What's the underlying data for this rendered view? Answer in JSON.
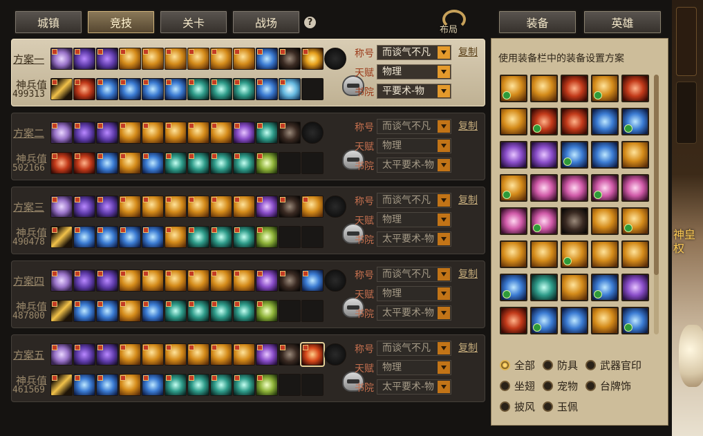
{
  "tabs": [
    {
      "label": "城镇",
      "active": false
    },
    {
      "label": "竞技",
      "active": true
    },
    {
      "label": "关卡",
      "active": false
    },
    {
      "label": "战场",
      "active": false
    }
  ],
  "help_icon_text": "?",
  "layout_button_label": "布局",
  "right_tabs": [
    "装备",
    "英雄"
  ],
  "world_glimpse_text": "神皇\n权",
  "colors": {
    "gold": "#e49a2c",
    "field_label": "#c6704f",
    "panel": "#2c2723",
    "active_panel": "#d9cdb4"
  },
  "plans": [
    {
      "name": "方案一",
      "power_label": "神兵值",
      "power": "499313",
      "active": true,
      "title_label": "称号",
      "title_value": "而谈气不凡",
      "talent_label": "天赋",
      "talent_value": "物理",
      "academy_label": "书院",
      "academy_value": "平要术-物",
      "copy_label": "复制",
      "row1": [
        "disc",
        "wing-purple",
        "wing-purple",
        "gold",
        "gold",
        "gold",
        "gold",
        "gold",
        "gold",
        "blue",
        "dark",
        "gold-wing",
        "ring"
      ],
      "row2": [
        "weapon",
        "red",
        "blue",
        "blue",
        "blue",
        "blue",
        "teal",
        "teal",
        "teal",
        "blue",
        "ice",
        "empty",
        "helmet"
      ]
    },
    {
      "name": "方案二",
      "power_label": "神兵值",
      "power": "502166",
      "active": false,
      "title_label": "称号",
      "title_value": "而谈气不凡",
      "talent_label": "天赋",
      "talent_value": "物理",
      "academy_label": "书院",
      "academy_value": "太平要术-物",
      "copy_label": "复制",
      "row1": [
        "disc",
        "wing-purple",
        "wing-purple",
        "gold",
        "gold",
        "gold",
        "gold",
        "gold",
        "purple",
        "teal",
        "dark",
        "ring"
      ],
      "row2": [
        "red",
        "red",
        "blue",
        "gold",
        "blue",
        "teal",
        "teal",
        "teal",
        "teal",
        "green",
        "empty",
        "empty",
        "helmet"
      ]
    },
    {
      "name": "方案三",
      "power_label": "神兵值",
      "power": "490478",
      "active": false,
      "title_label": "称号",
      "title_value": "而谈气不凡",
      "talent_label": "天赋",
      "talent_value": "物理",
      "academy_label": "书院",
      "academy_value": "太平要术-物",
      "copy_label": "复制",
      "row1": [
        "disc",
        "wing-purple",
        "wing-purple",
        "gold",
        "gold",
        "gold",
        "gold",
        "gold",
        "gold",
        "purple",
        "dark",
        "gold",
        "ring"
      ],
      "row2": [
        "weapon",
        "blue",
        "blue",
        "blue",
        "blue",
        "gold",
        "teal",
        "teal",
        "teal",
        "green",
        "empty",
        "empty",
        "helmet"
      ]
    },
    {
      "name": "方案四",
      "power_label": "神兵值",
      "power": "487800",
      "active": false,
      "title_label": "称号",
      "title_value": "而谈气不凡",
      "talent_label": "天赋",
      "talent_value": "物理",
      "academy_label": "书院",
      "academy_value": "太平要术-物",
      "copy_label": "复制",
      "row1": [
        "disc",
        "wing-purple",
        "wing-purple",
        "gold",
        "gold",
        "gold",
        "gold",
        "gold",
        "gold",
        "purple",
        "dark",
        "blue",
        "ring"
      ],
      "row2": [
        "weapon",
        "blue",
        "blue",
        "gold",
        "blue",
        "teal",
        "teal",
        "teal",
        "teal",
        "green",
        "empty",
        "empty",
        "helmet"
      ]
    },
    {
      "name": "方案五",
      "power_label": "神兵值",
      "power": "461569",
      "active": false,
      "title_label": "称号",
      "title_value": "而谈气不凡",
      "talent_label": "天赋",
      "talent_value": "物理",
      "academy_label": "书院",
      "academy_value": "太平要术-物",
      "copy_label": "复制",
      "row1": [
        "disc",
        "wing-purple",
        "wing-purple",
        "gold",
        "gold",
        "gold",
        "gold",
        "gold",
        "gold",
        "purple",
        "dark",
        "red-sel",
        "ring"
      ],
      "row2": [
        "weapon",
        "blue",
        "blue",
        "gold",
        "blue",
        "teal",
        "teal",
        "teal",
        "teal",
        "green",
        "empty",
        "empty",
        "helmet"
      ]
    }
  ],
  "equip_panel": {
    "hint": "使用装备栏中的装备设置方案",
    "items": [
      "gold",
      "gold",
      "red",
      "gold",
      "red",
      "gold",
      "red",
      "red",
      "blue",
      "blue",
      "purple",
      "purple",
      "blue",
      "blue",
      "gold",
      "gold",
      "pink",
      "pink",
      "pink",
      "pink",
      "pink",
      "pink",
      "dark",
      "gold",
      "gold",
      "gold",
      "gold",
      "gold",
      "gold",
      "gold",
      "blue",
      "teal",
      "gold",
      "blue",
      "purple",
      "red",
      "blue",
      "blue",
      "gold",
      "blue"
    ],
    "scroll_position": 0.0,
    "filters": [
      {
        "label": "全部",
        "checked": true
      },
      {
        "label": "防具",
        "checked": false
      },
      {
        "label": "武器官印",
        "checked": false
      },
      {
        "label": "坐翅",
        "checked": false
      },
      {
        "label": "宠物",
        "checked": false
      },
      {
        "label": "台牌饰",
        "checked": false
      },
      {
        "label": "披风",
        "checked": false
      },
      {
        "label": "玉佩",
        "checked": false
      }
    ]
  }
}
